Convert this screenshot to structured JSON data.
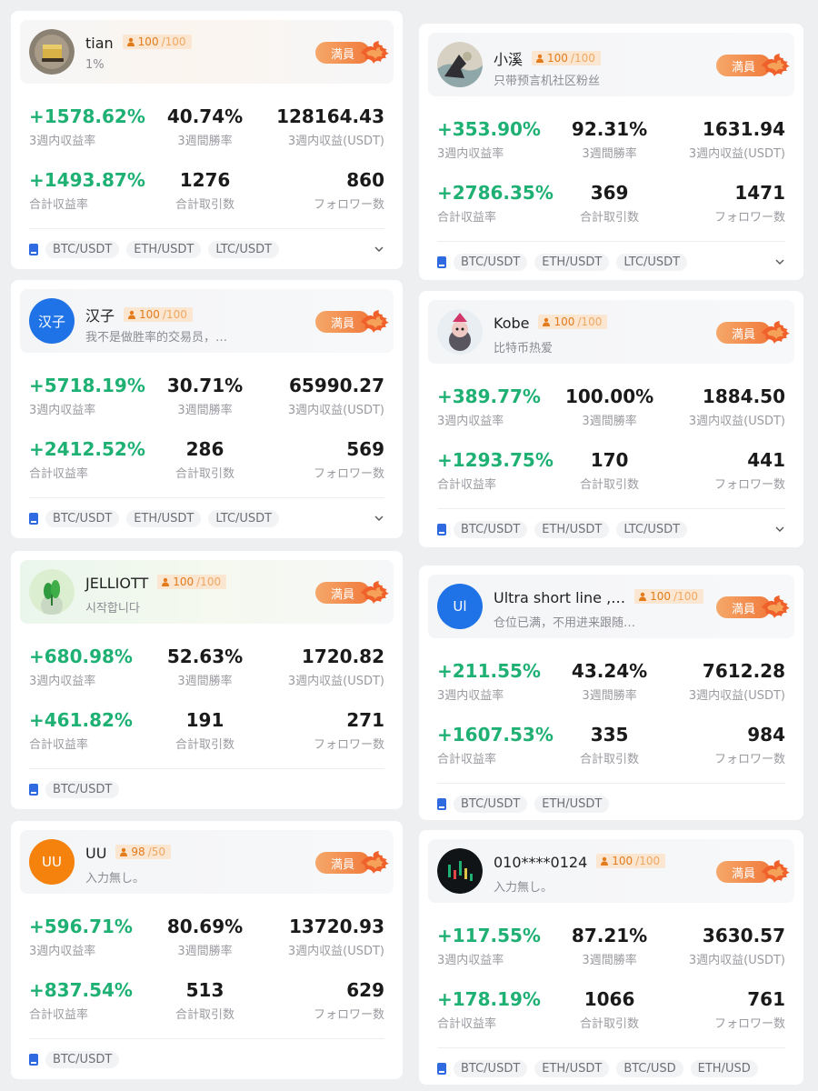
{
  "labels": {
    "full": "満員",
    "roi3w": "3週内収益率",
    "winrate": "3週間勝率",
    "profit": "3週内収益(USDT)",
    "total_roi": "合計収益率",
    "trades": "合計取引数",
    "followers": "フォロワー数"
  },
  "colors": {
    "positive": "#1fb074",
    "accent": "#f07a3c",
    "pair_icon": "#2f6ae0"
  },
  "cards": [
    {
      "name": "tian",
      "followers_now": "100",
      "followers_max": "/100",
      "sub": "1%",
      "avatar": "gold-bar-avatar",
      "roi3w": "+1578.62%",
      "winrate": "40.74%",
      "profit": "128164.43",
      "total_roi": "+1493.87%",
      "trades": "1276",
      "followers": "860",
      "pairs": [
        "BTC/USDT",
        "ETH/USDT",
        "LTC/USDT"
      ],
      "expand": true
    },
    {
      "name": "汉子",
      "followers_now": "100",
      "followers_max": "/100",
      "sub": "我不是做胜率的交易员，…",
      "avatar_text": "汉子",
      "avatar_color": "#1f73e6",
      "roi3w": "+5718.19%",
      "winrate": "30.71%",
      "profit": "65990.27",
      "total_roi": "+2412.52%",
      "trades": "286",
      "followers": "569",
      "pairs": [
        "BTC/USDT",
        "ETH/USDT",
        "LTC/USDT"
      ],
      "expand": true
    },
    {
      "name": "JELLIOTT",
      "followers_now": "100",
      "followers_max": "/100",
      "sub": "시작합니다",
      "avatar": "plant-avatar",
      "roi3w": "+680.98%",
      "winrate": "52.63%",
      "profit": "1720.82",
      "total_roi": "+461.82%",
      "trades": "191",
      "followers": "271",
      "pairs": [
        "BTC/USDT"
      ],
      "expand": false
    },
    {
      "name": "UU",
      "followers_now": "98",
      "followers_max": "/50",
      "sub": "入力無し。",
      "avatar_text": "UU",
      "avatar_color": "#f5820d",
      "roi3w": "+596.71%",
      "winrate": "80.69%",
      "profit": "13720.93",
      "total_roi": "+837.54%",
      "trades": "513",
      "followers": "629",
      "pairs": [
        "BTC/USDT"
      ],
      "expand": false
    },
    {
      "name": "小溪",
      "followers_now": "100",
      "followers_max": "/100",
      "sub": "只带预言机社区粉丝",
      "avatar": "painting-avatar",
      "roi3w": "+353.90%",
      "winrate": "92.31%",
      "profit": "1631.94",
      "total_roi": "+2786.35%",
      "trades": "369",
      "followers": "1471",
      "pairs": [
        "BTC/USDT",
        "ETH/USDT",
        "LTC/USDT"
      ],
      "expand": true
    },
    {
      "name": "Kobe",
      "followers_now": "100",
      "followers_max": "/100",
      "sub": "比特币热爱",
      "avatar": "cartoon-avatar",
      "roi3w": "+389.77%",
      "winrate": "100.00%",
      "profit": "1884.50",
      "total_roi": "+1293.75%",
      "trades": "170",
      "followers": "441",
      "pairs": [
        "BTC/USDT",
        "ETH/USDT",
        "LTC/USDT"
      ],
      "expand": true
    },
    {
      "name": "Ultra short line ,…",
      "followers_now": "100",
      "followers_max": "/100",
      "sub": "仓位已满，不用进来跟随…",
      "avatar_text": "Ul",
      "avatar_color": "#1f73e6",
      "roi3w": "+211.55%",
      "winrate": "43.24%",
      "profit": "7612.28",
      "total_roi": "+1607.53%",
      "trades": "335",
      "followers": "984",
      "pairs": [
        "BTC/USDT",
        "ETH/USDT"
      ],
      "expand": false
    },
    {
      "name": "010****0124",
      "followers_now": "100",
      "followers_max": "/100",
      "sub": "入力無し。",
      "avatar": "chart-avatar",
      "roi3w": "+117.55%",
      "winrate": "87.21%",
      "profit": "3630.57",
      "total_roi": "+178.19%",
      "trades": "1066",
      "followers": "761",
      "pairs": [
        "BTC/USDT",
        "ETH/USDT",
        "BTC/USD",
        "ETH/USD"
      ],
      "expand": false
    }
  ]
}
